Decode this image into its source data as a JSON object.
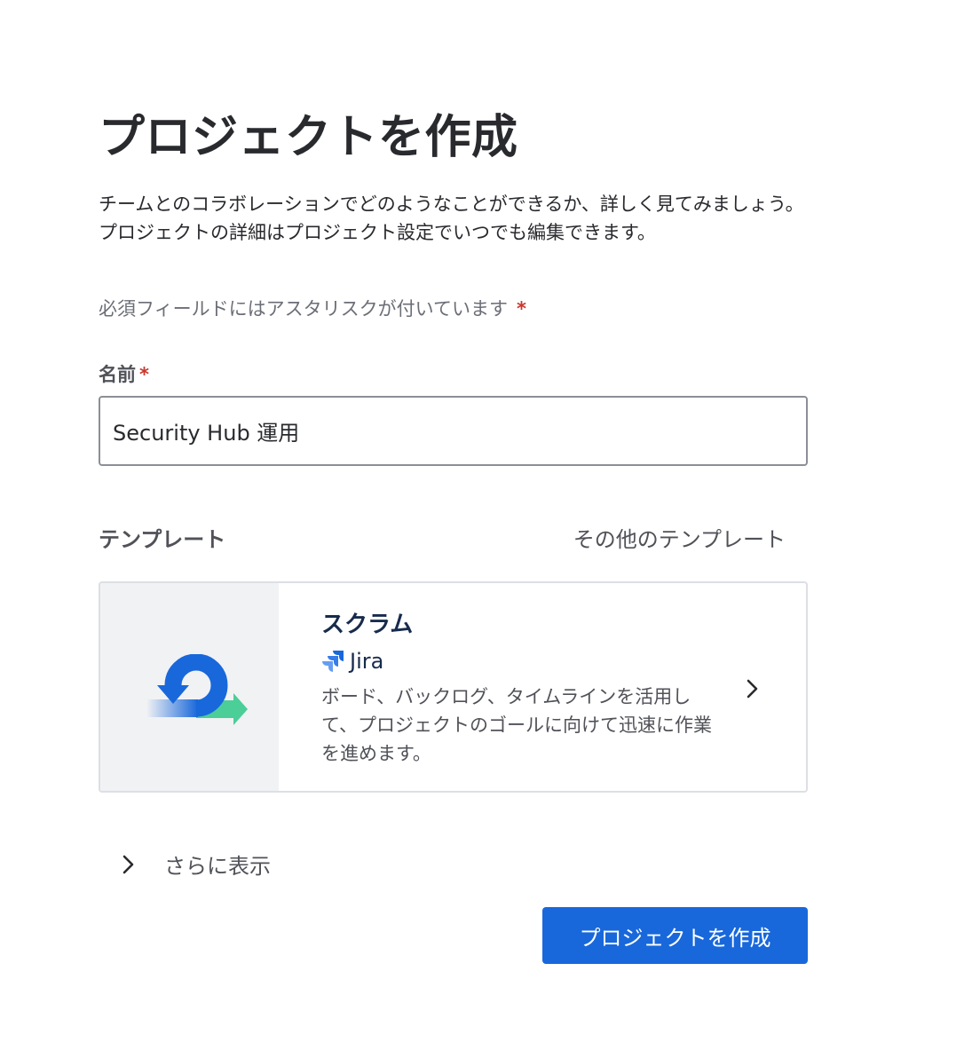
{
  "header": {
    "title": "プロジェクトを作成",
    "description": "チームとのコラボレーションでどのようなことができるか、詳しく見てみましょう。プロジェクトの詳細はプロジェクト設定でいつでも編集できます。"
  },
  "form": {
    "required_note": "必須フィールドにはアスタリスクが付いています",
    "required_marker": "*",
    "name_label": "名前",
    "name_value": "Security Hub 運用"
  },
  "templates": {
    "heading": "テンプレート",
    "more_link": "その他のテンプレート",
    "card": {
      "title": "スクラム",
      "product": "Jira",
      "description": "ボード、バックログ、タイムラインを活用して、プロジェクトのゴールに向けて迅速に作業を進めます。",
      "icon": "scrum-cycle-icon"
    }
  },
  "show_more": {
    "label": "さらに表示"
  },
  "actions": {
    "create_label": "プロジェクトを作成"
  },
  "colors": {
    "primary": "#1868db",
    "required": "#c9372c",
    "illustration_bg": "#f1f2f4",
    "scrum_green": "#4bce97"
  }
}
